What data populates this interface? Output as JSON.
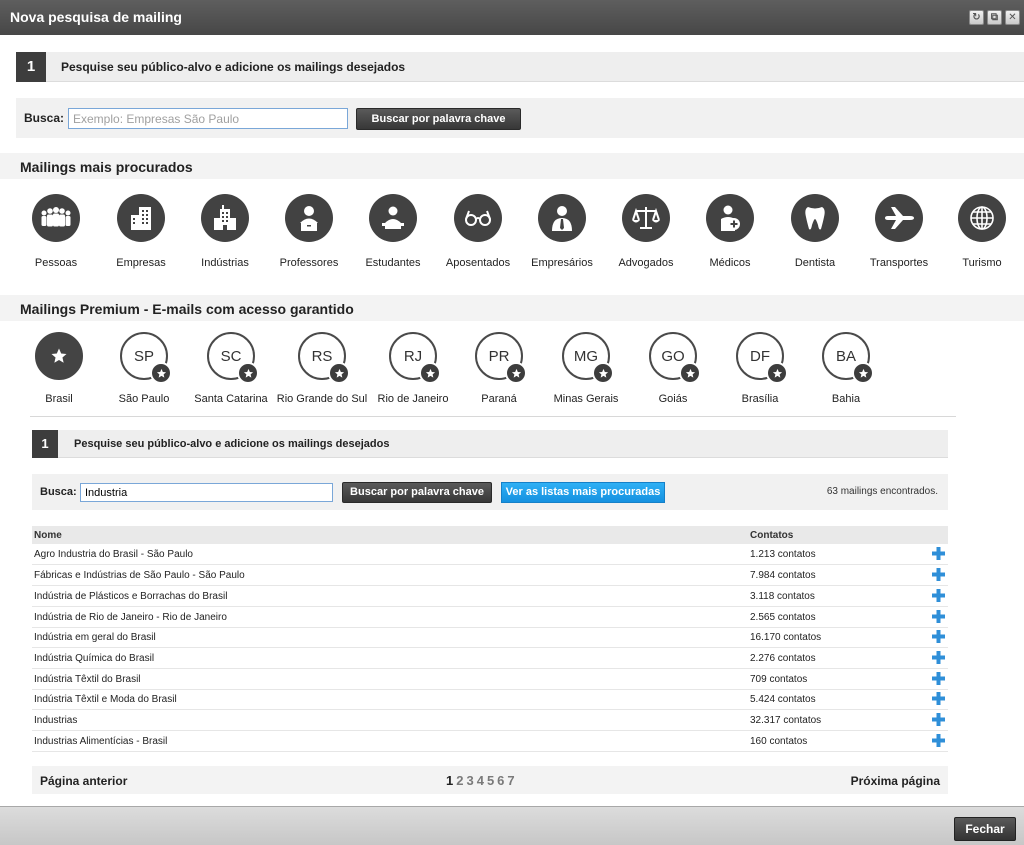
{
  "window": {
    "title": "Nova pesquisa de mailing",
    "controls": [
      "refresh-icon",
      "restore-icon",
      "close-icon"
    ]
  },
  "step1": {
    "number": "1",
    "text": "Pesquise seu público-alvo e adicione os mailings desejados"
  },
  "search1": {
    "label": "Busca:",
    "placeholder": "Exemplo: Empresas São Paulo",
    "value": "",
    "button": "Buscar por palavra chave"
  },
  "popular": {
    "title": "Mailings mais procurados",
    "items": [
      {
        "label": "Pessoas",
        "icon": "people-icon"
      },
      {
        "label": "Empresas",
        "icon": "building-icon"
      },
      {
        "label": "Indústrias",
        "icon": "factory-icon"
      },
      {
        "label": "Professores",
        "icon": "teacher-icon"
      },
      {
        "label": "Estudantes",
        "icon": "student-icon"
      },
      {
        "label": "Aposentados",
        "icon": "glasses-icon"
      },
      {
        "label": "Empresários",
        "icon": "businessman-icon"
      },
      {
        "label": "Advogados",
        "icon": "scales-icon"
      },
      {
        "label": "Médicos",
        "icon": "doctor-icon"
      },
      {
        "label": "Dentista",
        "icon": "tooth-icon"
      },
      {
        "label": "Transportes",
        "icon": "airplane-icon"
      },
      {
        "label": "Turismo",
        "icon": "globe-icon"
      }
    ]
  },
  "premium": {
    "title": "Mailings Premium - E-mails com acesso garantido",
    "items": [
      {
        "abbr": "",
        "label": "Brasil"
      },
      {
        "abbr": "SP",
        "label": "São Paulo"
      },
      {
        "abbr": "SC",
        "label": "Santa Catarina"
      },
      {
        "abbr": "RS",
        "label": "Rio Grande do Sul"
      },
      {
        "abbr": "RJ",
        "label": "Rio de Janeiro"
      },
      {
        "abbr": "PR",
        "label": "Paraná"
      },
      {
        "abbr": "MG",
        "label": "Minas Gerais"
      },
      {
        "abbr": "GO",
        "label": "Goiás"
      },
      {
        "abbr": "DF",
        "label": "Brasília"
      },
      {
        "abbr": "BA",
        "label": "Bahia"
      }
    ]
  },
  "step2": {
    "number": "1",
    "text": "Pesquise seu público-alvo e adicione os mailings desejados"
  },
  "search2": {
    "label": "Busca:",
    "value": "Industria",
    "button": "Buscar por palavra chave",
    "popular_button": "Ver as listas mais procuradas",
    "found": "63 mailings encontrados."
  },
  "table": {
    "headers": {
      "name": "Nome",
      "contacts": "Contatos"
    },
    "rows": [
      {
        "name": "Agro Industria do Brasil - São Paulo",
        "contacts": "1.213 contatos"
      },
      {
        "name": "Fábricas e Indústrias de São Paulo - São Paulo",
        "contacts": "7.984 contatos"
      },
      {
        "name": "Indústria de Plásticos e Borrachas do Brasil",
        "contacts": "3.118 contatos"
      },
      {
        "name": "Indústria de Rio de Janeiro - Rio de Janeiro",
        "contacts": "2.565 contatos"
      },
      {
        "name": "Indústria em geral do Brasil",
        "contacts": "16.170 contatos"
      },
      {
        "name": "Indústria Química do Brasil",
        "contacts": "2.276 contatos"
      },
      {
        "name": "Indústria Têxtil do Brasil",
        "contacts": "709 contatos"
      },
      {
        "name": "Indústria Têxtil e Moda do Brasil",
        "contacts": "5.424 contatos"
      },
      {
        "name": "Industrias",
        "contacts": "32.317 contatos"
      },
      {
        "name": "Industrias Alimentícias - Brasil",
        "contacts": "160 contatos"
      }
    ]
  },
  "pager": {
    "prev": "Página anterior",
    "next": "Próxima página",
    "pages": [
      "1",
      "2",
      "3",
      "4",
      "5",
      "6",
      "7"
    ],
    "current": "1"
  },
  "footer": {
    "close": "Fechar"
  },
  "colors": {
    "titlebar": "#474747",
    "dark_icon": "#424242",
    "blue_button": "#1591e0",
    "plus": "#2f8fd8"
  }
}
